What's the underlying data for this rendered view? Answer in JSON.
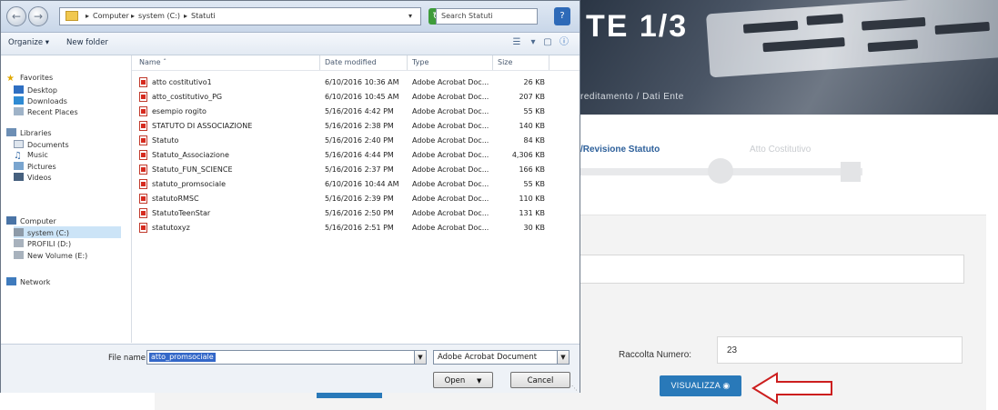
{
  "page": {
    "title_visible": "TE 1/3",
    "breadcrumb": "reditamento / Dati Ente",
    "steps": [
      "/Revisione Statuto",
      "Atto Costitutivo"
    ],
    "raccolta_label": "Raccolta Numero:",
    "raccolta_value": "23",
    "visualizza_label": "VISUALIZZA ◉",
    "arrow_color": "#cc1e1e",
    "accent": "#2979b9"
  },
  "dialog": {
    "address": {
      "segments": [
        "Computer",
        "system (C:)",
        "Statuti"
      ],
      "search_placeholder": "Search Statuti"
    },
    "toolbar": {
      "organize": "Organize ▾",
      "new_folder": "New folder"
    },
    "nav": [
      {
        "label": "Favorites",
        "icon": "star-icon",
        "level": 0
      },
      {
        "label": "Desktop",
        "icon": "desktop-icon",
        "level": 1
      },
      {
        "label": "Downloads",
        "icon": "downloads-icon",
        "level": 1
      },
      {
        "label": "Recent Places",
        "icon": "recent-icon",
        "level": 1
      },
      {
        "label": "Libraries",
        "icon": "library-icon",
        "level": 0
      },
      {
        "label": "Documents",
        "icon": "documents-icon",
        "level": 1
      },
      {
        "label": "Music",
        "icon": "music-icon",
        "level": 1
      },
      {
        "label": "Pictures",
        "icon": "pictures-icon",
        "level": 1
      },
      {
        "label": "Videos",
        "icon": "videos-icon",
        "level": 1
      },
      {
        "label": "Computer",
        "icon": "computer-icon",
        "level": 0
      },
      {
        "label": "system (C:)",
        "icon": "drive-icon",
        "level": 1
      },
      {
        "label": "PROFILI (D:)",
        "icon": "drive-icon",
        "level": 1
      },
      {
        "label": "New Volume (E:)",
        "icon": "drive-icon",
        "level": 1
      },
      {
        "label": "Network",
        "icon": "network-icon",
        "level": 0
      }
    ],
    "columns": [
      "Name",
      "Date modified",
      "Type",
      "Size"
    ],
    "files": [
      {
        "name": "atto costitutivo1",
        "date": "6/10/2016 10:36 AM",
        "type": "Adobe Acrobat Doc...",
        "size": "26 KB"
      },
      {
        "name": "atto_costitutivo_PG",
        "date": "6/10/2016 10:45 AM",
        "type": "Adobe Acrobat Doc...",
        "size": "207 KB"
      },
      {
        "name": "esempio rogito",
        "date": "5/16/2016 4:42 PM",
        "type": "Adobe Acrobat Doc...",
        "size": "55 KB"
      },
      {
        "name": "STATUTO DI ASSOCIAZIONE",
        "date": "5/16/2016 2:38 PM",
        "type": "Adobe Acrobat Doc...",
        "size": "140 KB"
      },
      {
        "name": "Statuto",
        "date": "5/16/2016 2:40 PM",
        "type": "Adobe Acrobat Doc...",
        "size": "84 KB"
      },
      {
        "name": "Statuto_Associazione",
        "date": "5/16/2016 4:44 PM",
        "type": "Adobe Acrobat Doc...",
        "size": "4,306 KB"
      },
      {
        "name": "Statuto_FUN_SCIENCE",
        "date": "5/16/2016 2:37 PM",
        "type": "Adobe Acrobat Doc...",
        "size": "166 KB"
      },
      {
        "name": "statuto_promsociale",
        "date": "6/10/2016 10:44 AM",
        "type": "Adobe Acrobat Doc...",
        "size": "55 KB"
      },
      {
        "name": "statutoRMSC",
        "date": "5/16/2016 2:39 PM",
        "type": "Adobe Acrobat Doc...",
        "size": "110 KB"
      },
      {
        "name": "StatutoTeenStar",
        "date": "5/16/2016 2:50 PM",
        "type": "Adobe Acrobat Doc...",
        "size": "131 KB"
      },
      {
        "name": "statutoxyz",
        "date": "5/16/2016 2:51 PM",
        "type": "Adobe Acrobat Doc...",
        "size": "30 KB"
      }
    ],
    "footer": {
      "filename_label": "File name:",
      "filename_value": "atto_promsociale",
      "filetype": "Adobe Acrobat Document",
      "open": "Open",
      "cancel": "Cancel"
    }
  }
}
